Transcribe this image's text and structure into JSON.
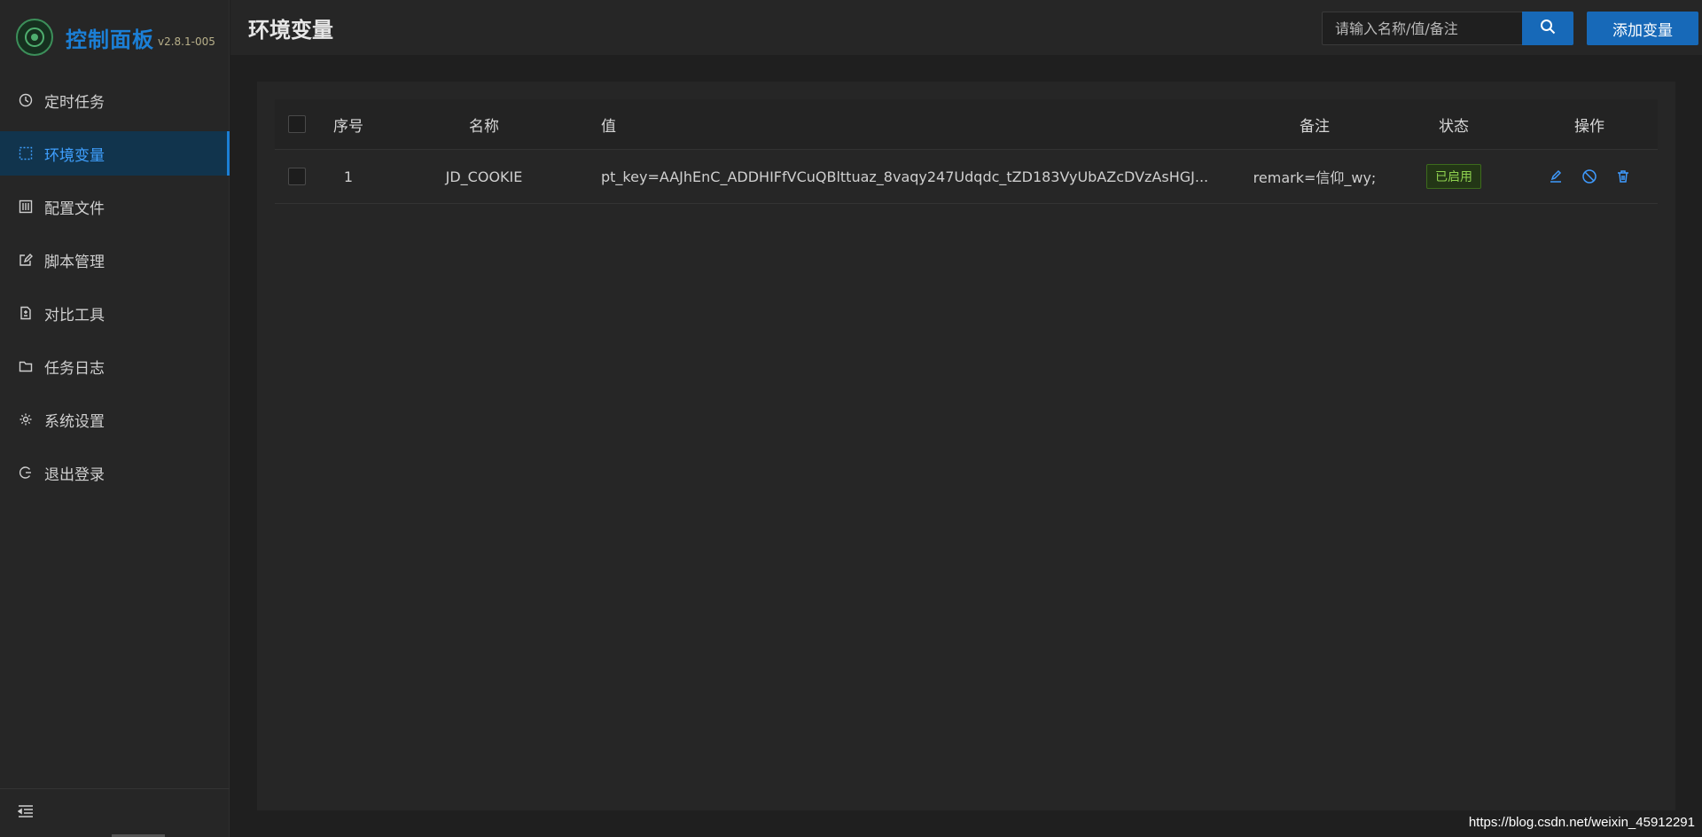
{
  "brand": {
    "title": "控制面板",
    "version": "v2.8.1-005"
  },
  "sidebar": {
    "items": [
      {
        "label": "定时任务",
        "icon": "clock-icon",
        "active": false
      },
      {
        "label": "环境变量",
        "icon": "dashed-box-icon",
        "active": true
      },
      {
        "label": "配置文件",
        "icon": "sliders-icon",
        "active": false
      },
      {
        "label": "脚本管理",
        "icon": "edit-icon",
        "active": false
      },
      {
        "label": "对比工具",
        "icon": "diff-icon",
        "active": false
      },
      {
        "label": "任务日志",
        "icon": "folder-icon",
        "active": false
      },
      {
        "label": "系统设置",
        "icon": "gear-icon",
        "active": false
      },
      {
        "label": "退出登录",
        "icon": "logout-icon",
        "active": false
      }
    ]
  },
  "header": {
    "title": "环境变量",
    "search_placeholder": "请输入名称/值/备注",
    "add_label": "添加变量"
  },
  "table": {
    "columns": {
      "idx": "序号",
      "name": "名称",
      "value": "值",
      "remark": "备注",
      "status": "状态",
      "ops": "操作"
    },
    "rows": [
      {
        "idx": "1",
        "name": "JD_COOKIE",
        "value": "pt_key=AAJhEnC_ADDHIFfVCuQBlttuaz_8vaqy247Udqdc_tZD183VyUbAZcDVzAsHGJ...",
        "remark": "remark=信仰_wy;",
        "status": "已启用"
      }
    ]
  },
  "watermark": "https://blog.csdn.net/weixin_45912291",
  "colors": {
    "accent": "#1769b8",
    "active_text": "#3fa0ff",
    "status_green": "#8fd14f",
    "redact": "#7ccfff"
  }
}
